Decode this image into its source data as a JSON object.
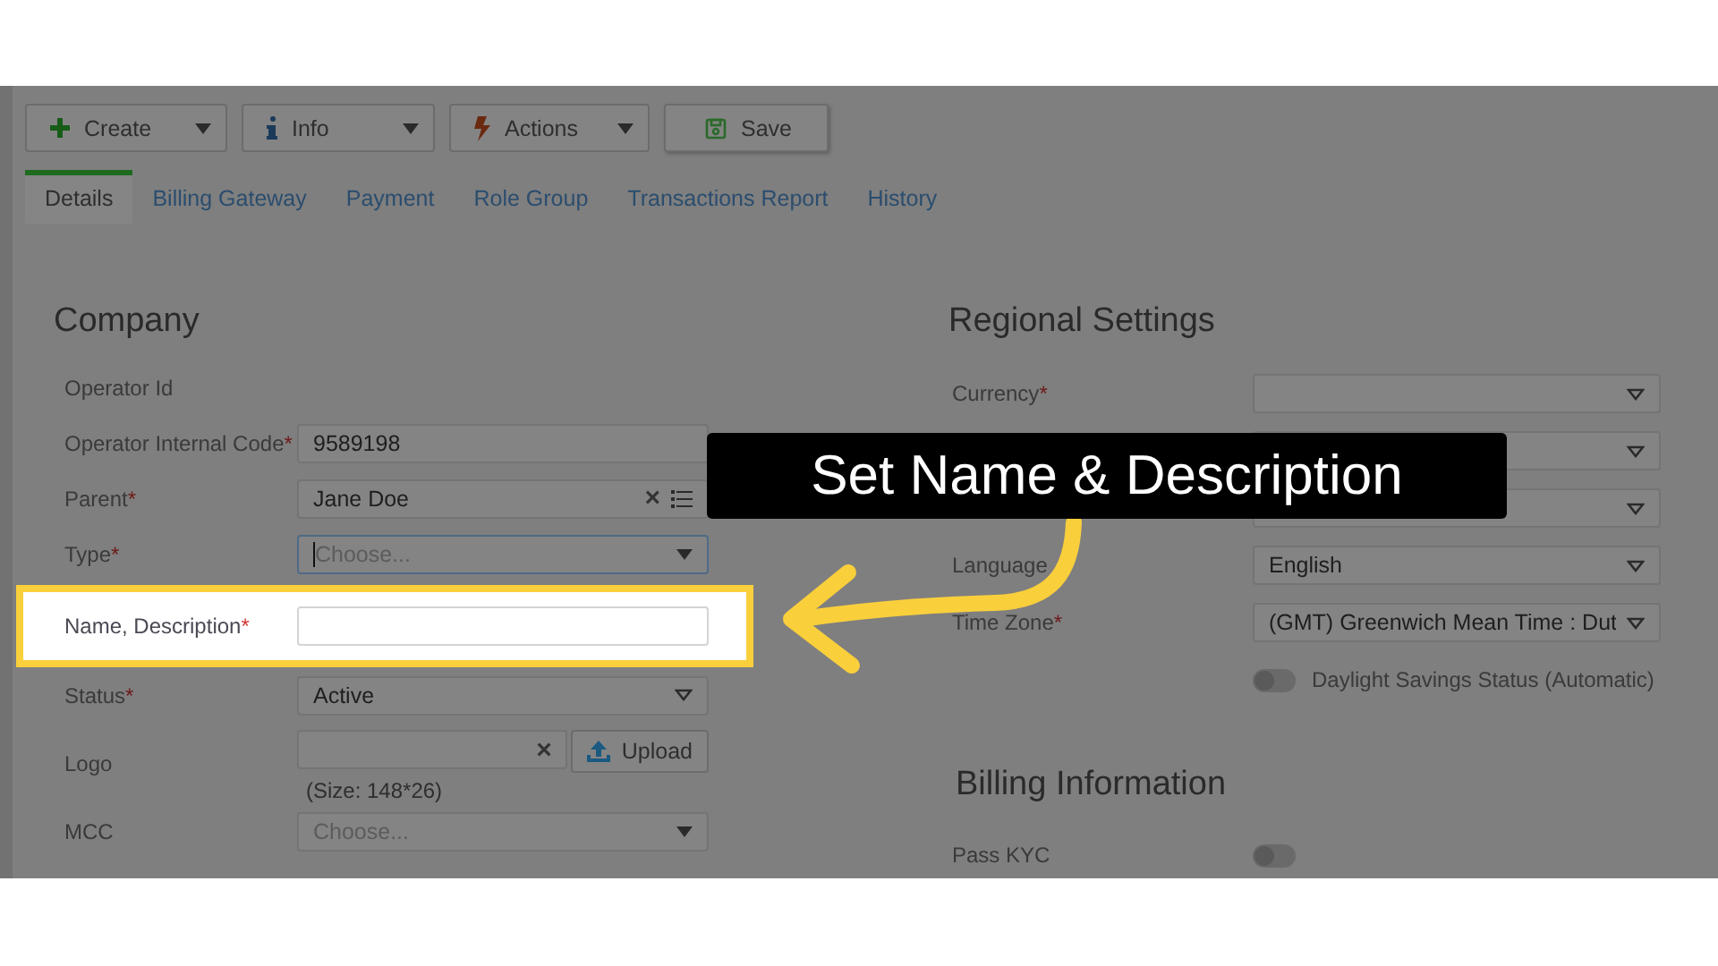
{
  "toolbar": [
    {
      "label": "Create",
      "kind": "create",
      "dropdown": true
    },
    {
      "label": "Info",
      "kind": "info",
      "dropdown": true
    },
    {
      "label": "Actions",
      "kind": "actions",
      "dropdown": true
    },
    {
      "label": "Save",
      "kind": "save",
      "dropdown": false
    }
  ],
  "tabs": [
    {
      "label": "Details",
      "selected": true
    },
    {
      "label": "Billing Gateway",
      "selected": false
    },
    {
      "label": "Payment",
      "selected": false
    },
    {
      "label": "Role Group",
      "selected": false
    },
    {
      "label": "Transactions Report",
      "selected": false
    },
    {
      "label": "History",
      "selected": false
    }
  ],
  "company": {
    "title": "Company",
    "fields": [
      {
        "kind": "static",
        "label": "Operator Id"
      },
      {
        "kind": "text",
        "label": "Operator Internal Code",
        "required_mark": "*",
        "value": "9589198"
      },
      {
        "kind": "lookup",
        "label": "Parent",
        "required_mark": "*",
        "value": "Jane Doe",
        "clear": "×"
      },
      {
        "kind": "combo",
        "label": "Type",
        "required_mark": "*",
        "placeholder": "Choose...",
        "focused": true
      },
      {
        "kind": "text",
        "label": "Name, Description",
        "required_mark": "*",
        "highlighted": true
      },
      {
        "kind": "select",
        "label": "Status",
        "required_mark": "*",
        "value": "Active"
      },
      {
        "kind": "upload",
        "label": "Logo",
        "clear": "×",
        "button": "Upload",
        "hint": "(Size: 148*26)"
      },
      {
        "kind": "combo",
        "label": "MCC",
        "placeholder": "Choose..."
      }
    ]
  },
  "regional": {
    "title": "Regional Settings",
    "fields": [
      {
        "kind": "select",
        "label": "Currency",
        "required_mark": "*"
      },
      {
        "kind": "select"
      },
      {
        "kind": "select"
      },
      {
        "kind": "select",
        "label": "Language",
        "value": "English"
      },
      {
        "kind": "select",
        "label": "Time Zone",
        "required_mark": "*",
        "value": "(GMT) Greenwich Mean Time : Dut"
      },
      {
        "kind": "toggle",
        "text": "Daylight Savings Status (Automatic)",
        "on": false
      }
    ]
  },
  "billing": {
    "title": "Billing Information",
    "fields": [
      {
        "kind": "toggle",
        "label": "Pass KYC",
        "on": false
      }
    ]
  },
  "callout": {
    "text": "Set Name & Description"
  }
}
